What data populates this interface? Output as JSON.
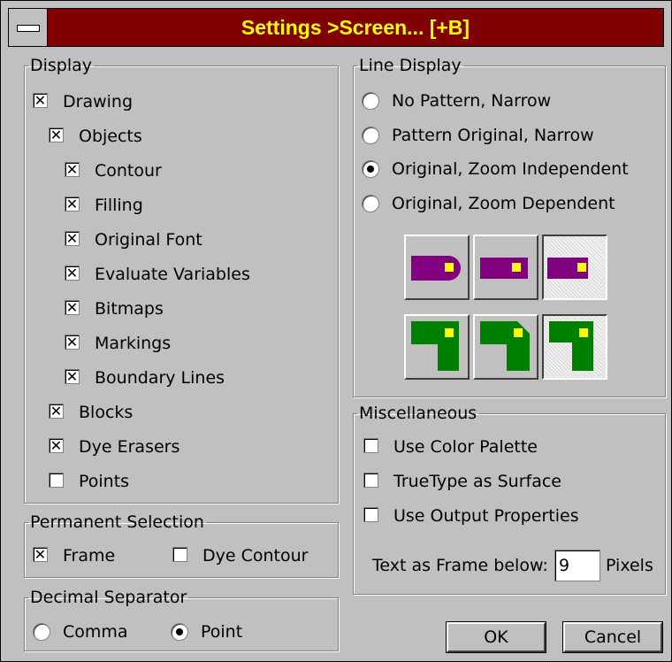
{
  "window": {
    "title": "Settings >Screen... [+B]"
  },
  "display": {
    "legend": "Display",
    "items": [
      {
        "label": "Drawing",
        "checked": true
      },
      {
        "label": "Objects",
        "checked": true
      },
      {
        "label": "Contour",
        "checked": true
      },
      {
        "label": "Filling",
        "checked": true
      },
      {
        "label": "Original Font",
        "checked": true
      },
      {
        "label": "Evaluate Variables",
        "checked": true
      },
      {
        "label": "Bitmaps",
        "checked": true
      },
      {
        "label": "Markings",
        "checked": true
      },
      {
        "label": "Boundary Lines",
        "checked": true
      },
      {
        "label": "Blocks",
        "checked": true
      },
      {
        "label": "Dye Erasers",
        "checked": true
      },
      {
        "label": "Points",
        "checked": false
      }
    ]
  },
  "permanent_selection": {
    "legend": "Permanent Selection",
    "frame": {
      "label": "Frame",
      "checked": true
    },
    "dye_contour": {
      "label": "Dye Contour",
      "checked": false
    }
  },
  "decimal_separator": {
    "legend": "Decimal Separator",
    "comma": {
      "label": "Comma",
      "selected": false
    },
    "point": {
      "label": "Point",
      "selected": true
    }
  },
  "line_display": {
    "legend": "Line Display",
    "options": [
      {
        "label": "No Pattern, Narrow",
        "selected": false
      },
      {
        "label": "Pattern Original, Narrow",
        "selected": false
      },
      {
        "label": "Original, Zoom Independent",
        "selected": true
      },
      {
        "label": "Original, Zoom Dependent",
        "selected": false
      }
    ],
    "colors": {
      "purple": "#800080",
      "green": "#008000",
      "yellow": "#ffff00"
    }
  },
  "miscellaneous": {
    "legend": "Miscellaneous",
    "items": [
      {
        "label": "Use Color Palette",
        "checked": false
      },
      {
        "label": "TrueType as Surface",
        "checked": false
      },
      {
        "label": "Use Output Properties",
        "checked": false
      }
    ],
    "text_frame_label": "Text as Frame below:",
    "text_frame_value": "9",
    "pixels_label": "Pixels"
  },
  "buttons": {
    "ok": "OK",
    "cancel": "Cancel"
  },
  "icons": {
    "check": "✕"
  }
}
